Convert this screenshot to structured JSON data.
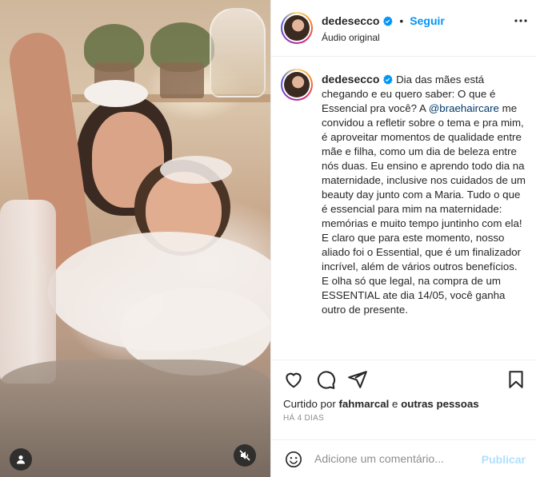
{
  "post": {
    "author": "dedesecco",
    "audio_label": "Áudio original",
    "follow_label": "Seguir",
    "separator": "•",
    "verified": true,
    "icons": {
      "verified": "verified-badge-icon",
      "more": "more-options-icon",
      "like": "heart-icon",
      "comment": "comment-icon",
      "share": "send-icon",
      "save": "bookmark-icon",
      "emoji": "emoji-icon",
      "tagged_user": "user-icon",
      "mute": "muted-speaker-icon"
    }
  },
  "caption": {
    "author": "dedesecco",
    "text_before_mention": "Dia das mães está chegando e eu quero saber: O que é Essencial pra você? A",
    "mention": "@braehaircare",
    "text_after_mention": "me convidou a refletir sobre o tema e pra mim, é aproveitar momentos de qualidade entre mãe e filha, como um dia de beleza entre nós duas. Eu ensino e aprendo todo dia na maternidade, inclusive nos cuidados de um beauty day junto com a Maria. Tudo o que é essencial para mim na maternidade: memórias e muito tempo juntinho com ela! E claro que para este momento, nosso aliado foi o Essential, que é um finalizador incrível, além de vários outros benefícios.",
    "paragraph2": "E olha só que legal, na compra de um ESSENTIAL ate dia 14/05, você ganha outro de presente."
  },
  "engagement": {
    "liked_by_prefix": "Curtido por",
    "liked_by_user": "fahmarcal",
    "liked_by_connector": "e",
    "liked_by_others": "outras pessoas",
    "time_ago": "HÁ 4 DIAS"
  },
  "comment_box": {
    "placeholder": "Adicione um comentário...",
    "publish_label": "Publicar"
  },
  "colors": {
    "accent": "#0095f6",
    "publish_disabled": "#b2dffc",
    "mention": "#00376b",
    "muted_text": "#8e8e8e",
    "border": "#efefef"
  }
}
